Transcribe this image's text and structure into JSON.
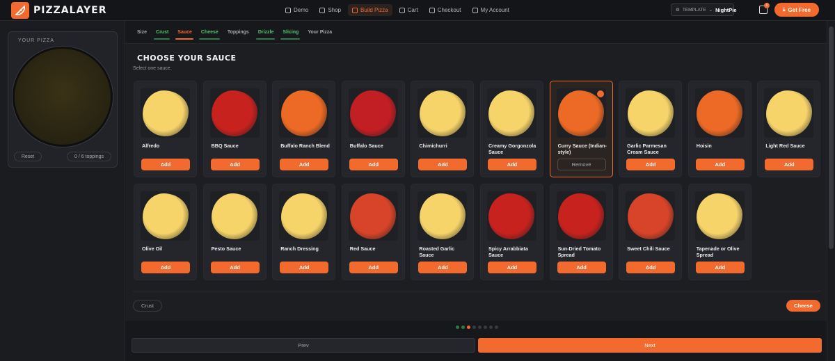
{
  "brand": {
    "name": "PIZZALAYER",
    "accent": "#f26a2e"
  },
  "nav": [
    {
      "label": "Demo",
      "icon": "home-icon"
    },
    {
      "label": "Shop",
      "icon": "shop-icon"
    },
    {
      "label": "Build Pizza",
      "icon": "pizza-icon",
      "active": true
    },
    {
      "label": "Cart",
      "icon": "cart-icon"
    },
    {
      "label": "Checkout",
      "icon": "checkout-icon"
    },
    {
      "label": "My Account",
      "icon": "account-icon"
    }
  ],
  "template": {
    "label": "TEMPLATE",
    "value": "NightPie"
  },
  "cart": {
    "count": "0"
  },
  "get_free": "Get Free",
  "sidebar": {
    "title": "YOUR PIZZA",
    "reset": "Reset",
    "toppings_count": "0  / 6 toppings"
  },
  "tabs": [
    {
      "label": "Size",
      "state": "normal"
    },
    {
      "label": "Crust",
      "state": "done"
    },
    {
      "label": "Sauce",
      "state": "active"
    },
    {
      "label": "Cheese",
      "state": "done"
    },
    {
      "label": "Toppings",
      "state": "normal"
    },
    {
      "label": "Drizzle",
      "state": "done"
    },
    {
      "label": "Slicing",
      "state": "done"
    },
    {
      "label": "Your Pizza",
      "state": "normal"
    }
  ],
  "section": {
    "title": "Choose Your Sauce",
    "subtitle": "Select one sauce."
  },
  "sauces": [
    {
      "name": "Alfredo",
      "color": "#f6d46a",
      "action": "Add"
    },
    {
      "name": "BBQ Sauce",
      "color": "#c8221f",
      "action": "Add"
    },
    {
      "name": "Buffalo Ranch Blend",
      "color": "#ec6a25",
      "action": "Add"
    },
    {
      "name": "Buffalo Sauce",
      "color": "#c21f24",
      "action": "Add"
    },
    {
      "name": "Chimichurri",
      "color": "#f6d46a",
      "action": "Add"
    },
    {
      "name": "Creamy Gorgonzola Sauce",
      "color": "#f6d46a",
      "action": "Add"
    },
    {
      "name": "Curry Sauce (Indian-style)",
      "color": "#ec6a25",
      "action": "Remove",
      "selected": true
    },
    {
      "name": "Garlic Parmesan Cream Sauce",
      "color": "#f6d46a",
      "action": "Add"
    },
    {
      "name": "Hoisin",
      "color": "#ec6a25",
      "action": "Add"
    },
    {
      "name": "Light Red Sauce",
      "color": "#f6d46a",
      "action": "Add"
    },
    {
      "name": "Olive Oil",
      "color": "#f6d46a",
      "action": "Add"
    },
    {
      "name": "Pesto Sauce",
      "color": "#f6d46a",
      "action": "Add"
    },
    {
      "name": "Ranch Dressing",
      "color": "#f6d46a",
      "action": "Add"
    },
    {
      "name": "Red Sauce",
      "color": "#d8442a",
      "action": "Add"
    },
    {
      "name": "Roasted Garlic Sauce",
      "color": "#f6d46a",
      "action": "Add"
    },
    {
      "name": "Spicy Arrabbiata Sauce",
      "color": "#c8221f",
      "action": "Add"
    },
    {
      "name": "Sun-Dried Tomato Spread",
      "color": "#c8221f",
      "action": "Add"
    },
    {
      "name": "Sweet Chili Sauce",
      "color": "#d8442a",
      "action": "Add"
    },
    {
      "name": "Tapenade or Olive Spread",
      "color": "#f6d46a",
      "action": "Add"
    }
  ],
  "step_nav": {
    "back": "Crust",
    "forward": "Cheese"
  },
  "progress_dots": [
    "done",
    "done",
    "active",
    "todo",
    "todo",
    "todo",
    "todo",
    "todo"
  ],
  "footer": {
    "prev": "Prev",
    "next": "Next"
  }
}
